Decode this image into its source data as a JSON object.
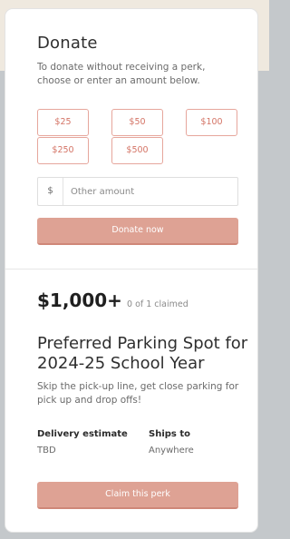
{
  "donate": {
    "title": "Donate",
    "subtitle": "To donate without receiving a perk, choose or enter an amount below.",
    "amounts": [
      "$25",
      "$50",
      "$100",
      "$250",
      "$500"
    ],
    "currency_symbol": "$",
    "other_placeholder": "Other amount",
    "other_value": "",
    "submit_label": "Donate now"
  },
  "perk": {
    "price": "$1,000+",
    "claimed": "0 of 1 claimed",
    "title": "Preferred Parking Spot for 2024-25 School Year",
    "description": "Skip the pick-up line, get close parking for pick up and drop offs!",
    "delivery_label": "Delivery estimate",
    "delivery_value": "TBD",
    "ships_label": "Ships to",
    "ships_value": "Anywhere",
    "claim_label": "Claim this perk"
  },
  "colors": {
    "accent": "#dea294",
    "outline": "#e6a69c",
    "outline_text": "#d47466"
  }
}
